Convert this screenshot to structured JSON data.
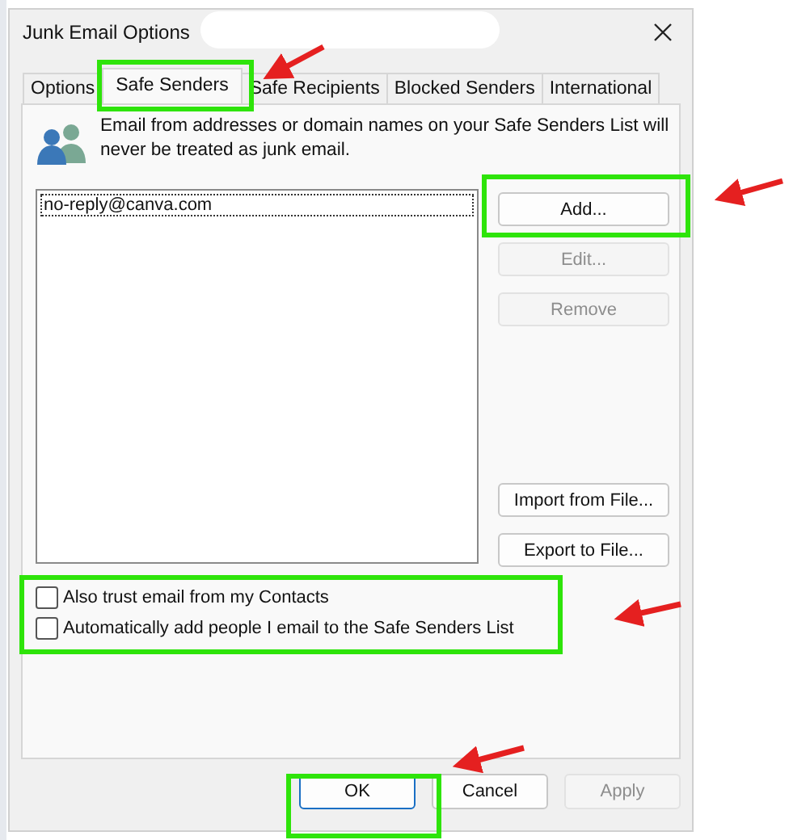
{
  "window": {
    "title": "Junk Email Options"
  },
  "tabs": [
    {
      "label": "Options",
      "selected": false
    },
    {
      "label": "Safe Senders",
      "selected": true
    },
    {
      "label": "Safe Recipients",
      "selected": false
    },
    {
      "label": "Blocked Senders",
      "selected": false
    },
    {
      "label": "International",
      "selected": false
    }
  ],
  "description": "Email from addresses or domain names on your Safe Senders List will never be treated as junk email.",
  "senders": [
    {
      "address": "no-reply@canva.com",
      "focused": true
    }
  ],
  "side_buttons": [
    {
      "label": "Add...",
      "disabled": false
    },
    {
      "label": "Edit...",
      "disabled": true
    },
    {
      "label": "Remove",
      "disabled": true
    }
  ],
  "file_buttons": [
    {
      "label": "Import from File...",
      "disabled": false
    },
    {
      "label": "Export to File...",
      "disabled": false
    }
  ],
  "checkboxes": [
    {
      "label": "Also trust email from my Contacts",
      "checked": false
    },
    {
      "label": "Automatically add people I email to the Safe Senders List",
      "checked": false
    }
  ],
  "footer_buttons": [
    {
      "label": "OK",
      "default": true,
      "disabled": false
    },
    {
      "label": "Cancel",
      "default": false,
      "disabled": false
    },
    {
      "label": "Apply",
      "default": false,
      "disabled": true
    }
  ]
}
